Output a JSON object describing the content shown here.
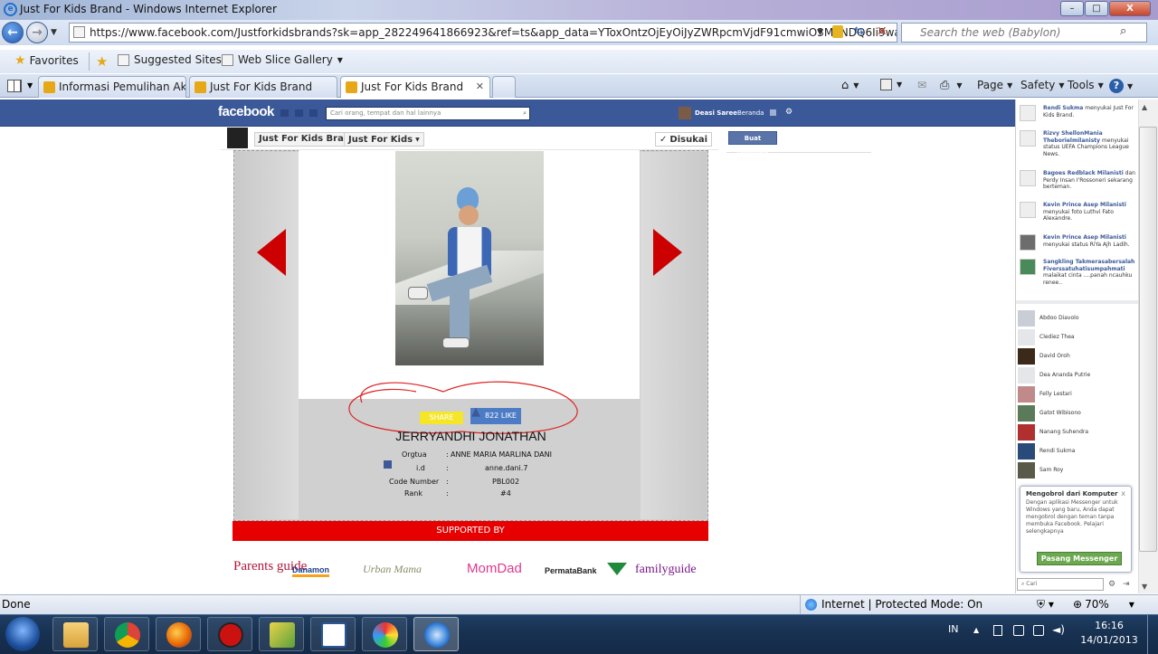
{
  "window": {
    "title": "Just For Kids Brand - Windows Internet Explorer",
    "minimize": "–",
    "maximize": "□",
    "close": "X"
  },
  "address": {
    "back": "←",
    "forward": "→",
    "url": "https://www.facebook.com/Justforkidsbrands?sk=app_282249641866923&ref=ts&app_data=YToxOntzOjEyOiJyZWRpcmVjdF91cmwiO3M6NDQ6Ii9waG90b19nYWxs",
    "search_placeholder": "Search the web (Babylon)"
  },
  "favorites": {
    "label": "Favorites",
    "suggested": "Suggested Sites",
    "webslice": "Web Slice Gallery"
  },
  "tabs": [
    {
      "label": "Informasi Pemulihan Akun"
    },
    {
      "label": "Just For Kids Brand"
    },
    {
      "label": "Just For Kids Brand"
    }
  ],
  "commandbar": {
    "page": "Page",
    "safety": "Safety",
    "tools": "Tools",
    "help": "?"
  },
  "facebook": {
    "logo": "facebook",
    "search_placeholder": "Cari orang, tempat dan hal lainnya",
    "user": "Deasi Saree",
    "home": "Beranda",
    "crumb_1": "Just For Kids Brand",
    "crumb_2": "Just For Kids",
    "liked": "Disukai",
    "create_page": "Buat Halaman"
  },
  "app": {
    "share": "SHARE",
    "likes": "822 LIKE",
    "name": "JERRYANDHI JONATHAN",
    "fields": [
      {
        "label": "Orgtua",
        "sep": ":",
        "value": "ANNE MARIA MARLINA DANI"
      },
      {
        "label": "i.d",
        "sep": ":",
        "value": "anne.dani.7"
      },
      {
        "label": "Code Number",
        "sep": ":",
        "value": "PBL002"
      },
      {
        "label": "Rank",
        "sep": ":",
        "value": "#4"
      }
    ],
    "supported_by": "SUPPORTED BY",
    "sponsors": [
      "Parents guide",
      "Danamon",
      "Urban Mama",
      "MomDad",
      "PermataBank",
      "familyguide"
    ]
  },
  "ticker": [
    {
      "name": "Rendi Sukma",
      "text": "menyukai Just For Kids Brand."
    },
    {
      "name": "Rizvy ShellonMania Theborielmilanisty",
      "text": "menyukai status UEFA Champions League News."
    },
    {
      "name": "Bagoes Redblack Milanisti",
      "text": "dan Perdy Insan I'Rossoneri sekarang berteman."
    },
    {
      "name": "Kevin Prince Asep Milanisti",
      "text": "menyukai foto Luthvi Fato Alexandre."
    },
    {
      "name": "Kevin Prince Asep Milanisti",
      "text": "menyukai status RiYa Ajh Ladih."
    },
    {
      "name": "Sangkling Takmerasabersalah Fiverssatuhatisumpahmati",
      "text": "malaikat cinta ....panah ncauhku renee.."
    }
  ],
  "friends": [
    "Abdoo Diavolo",
    "Clediez Thea",
    "David Oroh",
    "Dea Ananda Putrie",
    "Felly Lestari",
    "Gatot Wibisono",
    "Nanang Suhendra",
    "Rendi Sukma",
    "Sam Roy"
  ],
  "messenger": {
    "title": "Mengobrol dari Komputer",
    "close": "x",
    "desc": "Dengan aplikasi Messenger untuk Windows yang baru, Anda dapat mengobrol dengan teman tanpa membuka Facebook. Pelajari selengkapnya",
    "button": "Pasang Messenger",
    "chat_placeholder": "Cari"
  },
  "status": {
    "left": "Done",
    "zone": "Internet | Protected Mode: On",
    "zoom": "70%"
  },
  "taskbar": {
    "lang": "IN",
    "time": "16:16",
    "date": "14/01/2013"
  }
}
